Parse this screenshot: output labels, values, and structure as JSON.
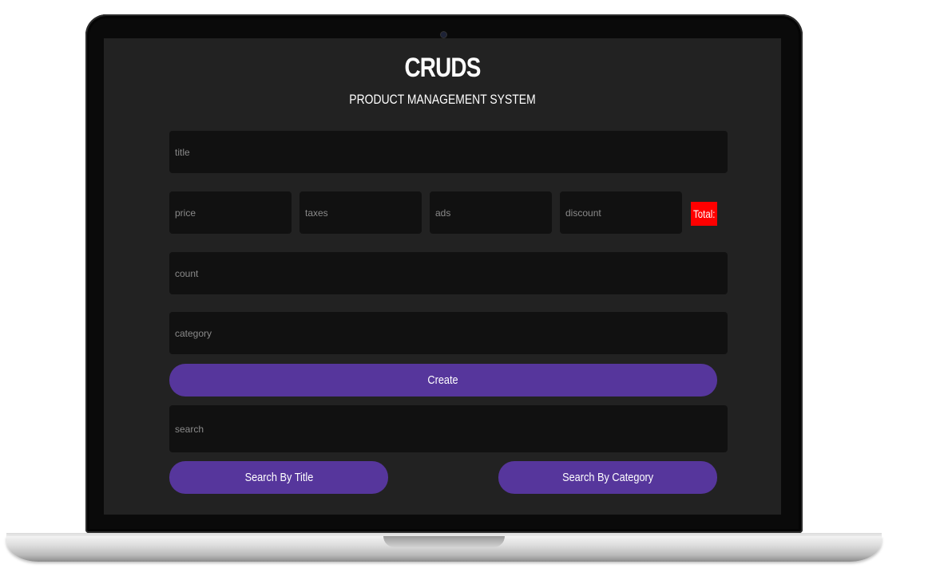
{
  "app": {
    "title": "CRUDS",
    "subtitle": "PRODUCT MANAGEMENT SYSTEM"
  },
  "form": {
    "title_placeholder": "title",
    "price_placeholder": "price",
    "taxes_placeholder": "taxes",
    "ads_placeholder": "ads",
    "discount_placeholder": "discount",
    "total_label": "Total:",
    "count_placeholder": "count",
    "category_placeholder": "category",
    "create_label": "Create"
  },
  "search": {
    "placeholder": "search",
    "by_title_label": "Search By Title",
    "by_category_label": "Search By Category"
  },
  "colors": {
    "screen_background": "#222222",
    "input_background": "#111111",
    "button": "#56369c",
    "total_badge": "#ff0000"
  }
}
